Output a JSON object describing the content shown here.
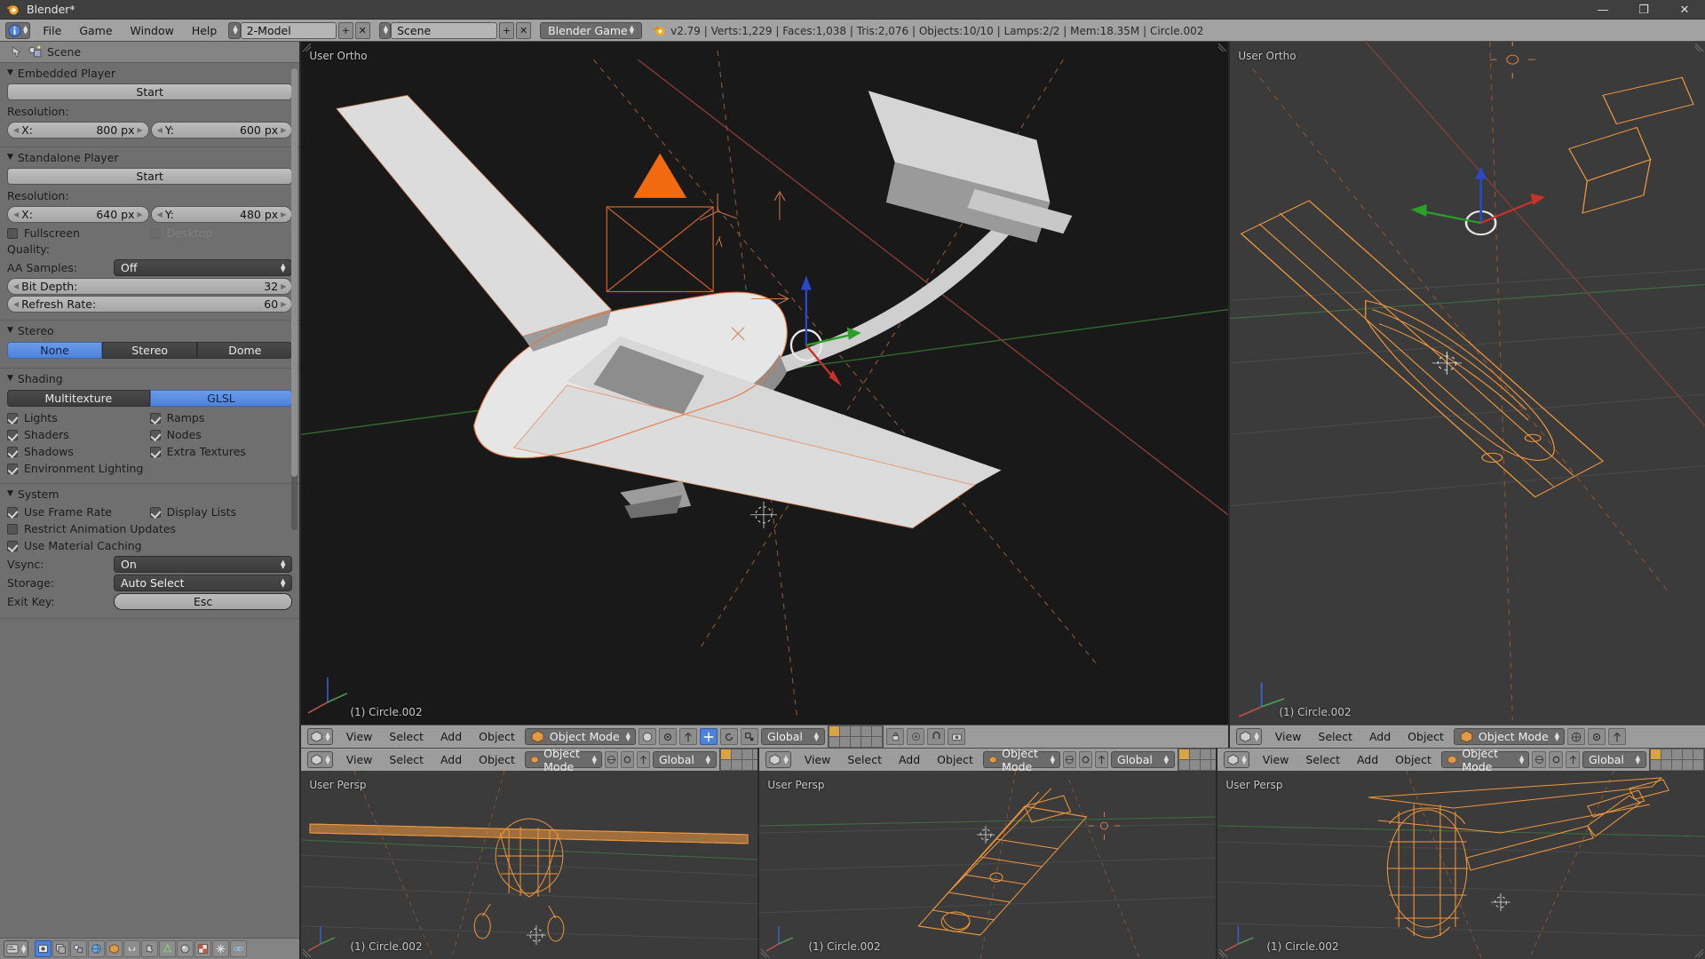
{
  "window": {
    "title": "Blender*",
    "minimize_label": "—",
    "maximize_label": "❐",
    "close_label": "✕"
  },
  "topbar": {
    "editor_icon": "info-editor-icon",
    "menus": [
      "File",
      "Game",
      "Window",
      "Help"
    ],
    "screen_layout": "2-Model",
    "screen_add_label": "+",
    "screen_del_label": "✕",
    "scene_name": "Scene",
    "scene_add_label": "+",
    "scene_del_label": "✕",
    "engine": "Blender Game",
    "stats": "v2.79 | Verts:1,229 | Faces:1,038 | Tris:2,076 | Objects:10/10 | Lamps:2/2 | Mem:18.35M | Circle.002"
  },
  "properties": {
    "breadcrumb_scene": "Scene",
    "pin_icon": "pin-icon",
    "scene_icon": "scene-icon",
    "panels": {
      "embedded_player": {
        "title": "Embedded Player",
        "start_label": "Start",
        "resolution_label": "Resolution:",
        "x_label": "X:",
        "x_value": "800 px",
        "y_label": "Y:",
        "y_value": "600 px"
      },
      "standalone_player": {
        "title": "Standalone Player",
        "start_label": "Start",
        "resolution_label": "Resolution:",
        "x_label": "X:",
        "x_value": "640 px",
        "y_label": "Y:",
        "y_value": "480 px",
        "fullscreen_label": "Fullscreen",
        "fullscreen_checked": false,
        "desktop_label": "Desktop",
        "desktop_checked": false,
        "quality_label": "Quality:",
        "aa_samples_label": "AA Samples:",
        "aa_samples_value": "Off",
        "bit_depth_label": "Bit Depth:",
        "bit_depth_value": "32",
        "refresh_rate_label": "Refresh Rate:",
        "refresh_rate_value": "60"
      },
      "stereo": {
        "title": "Stereo",
        "options": [
          "None",
          "Stereo",
          "Dome"
        ],
        "selected": "None"
      },
      "shading": {
        "title": "Shading",
        "modes": [
          "Multitexture",
          "GLSL"
        ],
        "selected": "GLSL",
        "checks_left": [
          {
            "label": "Lights",
            "checked": true
          },
          {
            "label": "Shaders",
            "checked": true
          },
          {
            "label": "Shadows",
            "checked": true
          },
          {
            "label": "Environment Lighting",
            "checked": true
          }
        ],
        "checks_right": [
          {
            "label": "Ramps",
            "checked": true
          },
          {
            "label": "Nodes",
            "checked": true
          },
          {
            "label": "Extra Textures",
            "checked": true
          }
        ]
      },
      "system": {
        "title": "System",
        "checks_left": [
          {
            "label": "Use Frame Rate",
            "checked": true
          },
          {
            "label": "Restrict Animation Updates",
            "checked": false
          },
          {
            "label": "Use Material Caching",
            "checked": true
          }
        ],
        "checks_right": [
          {
            "label": "Display Lists",
            "checked": true
          }
        ],
        "vsync_label": "Vsync:",
        "vsync_value": "On",
        "storage_label": "Storage:",
        "storage_value": "Auto Select",
        "exit_key_label": "Exit Key:",
        "exit_key_value": "Esc"
      }
    },
    "tabs": [
      "render-tab-icon",
      "render-layers-tab-icon",
      "scene-tab-icon",
      "world-tab-icon",
      "object-tab-icon",
      "constraints-tab-icon",
      "modifiers-tab-icon",
      "data-tab-icon",
      "material-tab-icon",
      "texture-tab-icon",
      "particles-tab-icon",
      "physics-tab-icon"
    ],
    "active_tab": "render-tab-icon"
  },
  "viewports": {
    "main": {
      "view_label": "User Ortho",
      "active_object": "(1) Circle.002",
      "header": {
        "editor_icon": "3d-view-editor-icon",
        "menus": [
          "View",
          "Select",
          "Add",
          "Object"
        ],
        "mode": "Object Mode",
        "orientation": "Global",
        "shading_icon": "solid-shading-icon",
        "pivot_icon": "pivot-median-icon",
        "snap_icon": "snap-magnet-icon"
      }
    },
    "right": {
      "view_label": "User Ortho",
      "active_object": "(1) Circle.002",
      "header": {
        "menus": [
          "View",
          "Select",
          "Add",
          "Object"
        ],
        "mode": "Object Mode",
        "editor_icon": "3d-view-editor-icon"
      }
    },
    "bottom": [
      {
        "view_label": "User Persp",
        "active_object": "(1) Circle.002",
        "header": {
          "menus": [
            "View",
            "Select",
            "Add",
            "Object"
          ],
          "mode": "Object Mode",
          "orientation": "Global",
          "editor_icon": "3d-view-editor-icon"
        }
      },
      {
        "view_label": "User Persp",
        "active_object": "(1) Circle.002",
        "header": {
          "menus": [
            "View",
            "Select",
            "Add",
            "Object"
          ],
          "mode": "Object Mode",
          "orientation": "Global",
          "editor_icon": "3d-view-editor-icon"
        }
      },
      {
        "view_label": "User Persp",
        "active_object": "(1) Circle.002",
        "header": {
          "menus": [
            "View",
            "Select",
            "Add",
            "Object"
          ],
          "mode": "Object Mode",
          "orientation": "Global",
          "editor_icon": "3d-view-editor-icon"
        }
      }
    ]
  },
  "colors": {
    "accent_blue": "#4e82da",
    "selection_orange": "#ff9a2e",
    "header_gray": "#9c9c9c",
    "panel_gray": "#6f6f6f",
    "viewport_bg": "#3b3b3b",
    "axis_x_red": "#c1504a",
    "axis_y_green": "#4a9f4a",
    "axis_z_blue": "#3a5fc8"
  }
}
